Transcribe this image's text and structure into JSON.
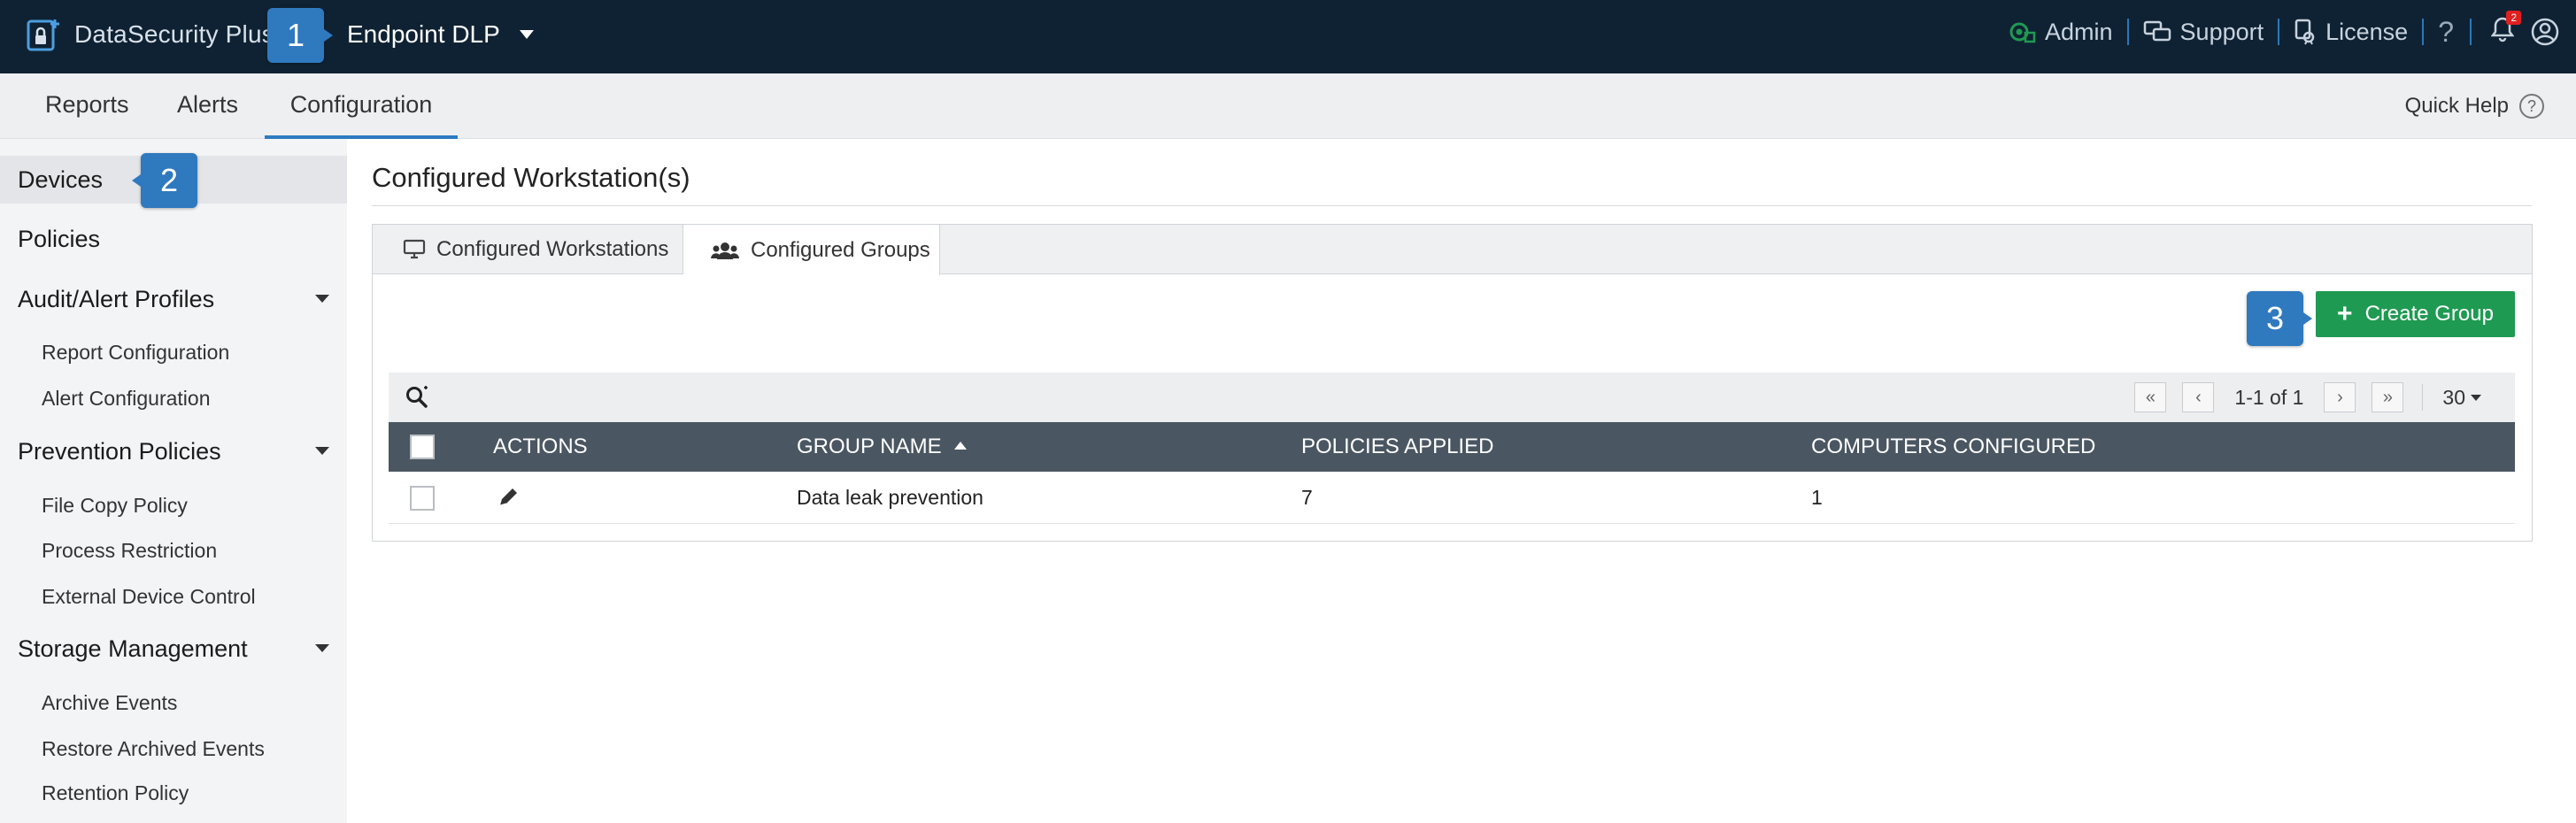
{
  "header": {
    "brand": "DataSecurity Plus",
    "product": "Endpoint DLP",
    "links": {
      "admin": "Admin",
      "support": "Support",
      "license": "License"
    },
    "help_glyph": "?",
    "notification_count": "2"
  },
  "nav": {
    "tabs": [
      "Reports",
      "Alerts",
      "Configuration"
    ],
    "active_tab": "Configuration",
    "quick_help": "Quick Help"
  },
  "sidebar": {
    "devices": "Devices",
    "policies": "Policies",
    "audit_alert_profiles": {
      "label": "Audit/Alert Profiles",
      "items": [
        "Report Configuration",
        "Alert Configuration"
      ]
    },
    "prevention_policies": {
      "label": "Prevention Policies",
      "items": [
        "File Copy Policy",
        "Process Restriction",
        "External Device Control"
      ]
    },
    "storage_management": {
      "label": "Storage Management",
      "items": [
        "Archive Events",
        "Restore Archived Events",
        "Retention Policy"
      ]
    }
  },
  "callouts": [
    "1",
    "2",
    "3"
  ],
  "main": {
    "title": "Configured Workstation(s)",
    "tabs": [
      "Configured Workstations",
      "Configured Groups"
    ],
    "active_tab": "Configured Groups",
    "create_button": "Create Group",
    "pager": {
      "info": "1-1 of 1",
      "page_size": "30"
    },
    "table": {
      "columns": [
        "ACTIONS",
        "GROUP NAME",
        "POLICIES APPLIED",
        "COMPUTERS CONFIGURED"
      ],
      "sorted_column": "GROUP NAME",
      "rows": [
        {
          "group_name": "Data leak prevention",
          "policies_applied": "7",
          "computers_configured": "1"
        }
      ]
    }
  },
  "colors": {
    "topbar": "#0f2233",
    "accent": "#2d7bc1",
    "callout": "#2f79bf",
    "create_button": "#1f9a52",
    "table_header": "#4a5661"
  }
}
